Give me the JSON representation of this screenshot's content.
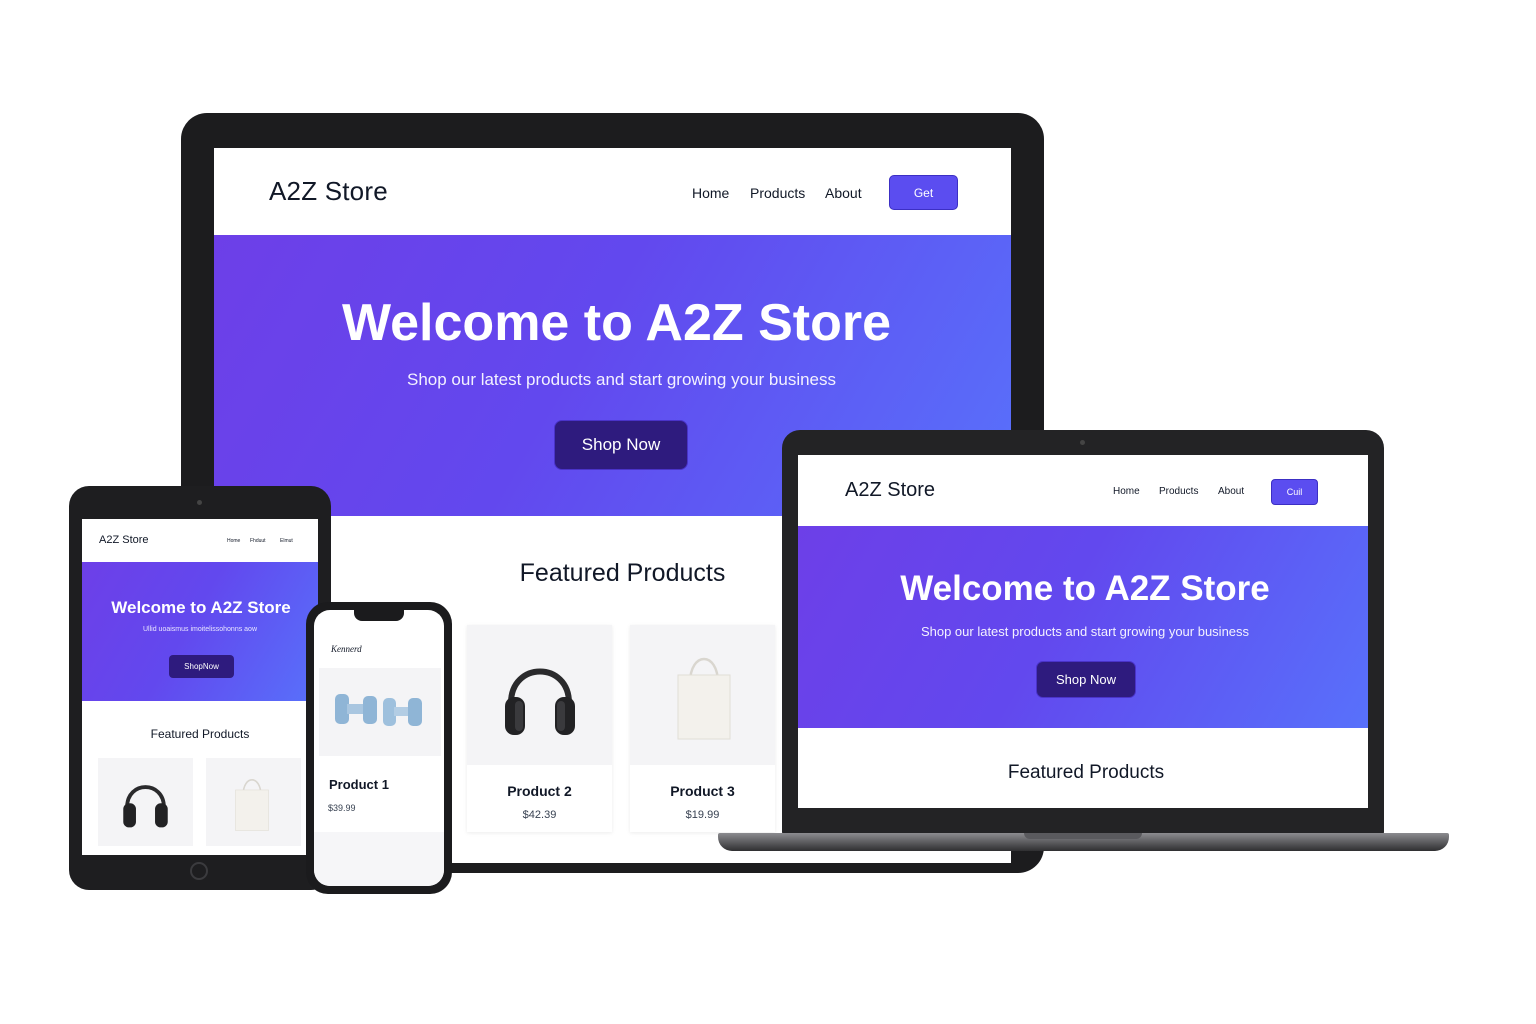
{
  "brand": {
    "name": "A2Z Store",
    "accent": "#5b4df0",
    "dark_button": "#2e1b7e"
  },
  "monitor": {
    "logo": "A2Z Store",
    "nav": [
      "Home",
      "Products",
      "About"
    ],
    "cta": "Get",
    "hero_title": "Welcome to A2Z Store",
    "hero_subtitle": "Shop our latest products and start growing your business",
    "hero_button": "Shop Now",
    "section_title": "Featured Products",
    "products": [
      {
        "name": "Product 2",
        "price": "$42.39",
        "image": "headphones-icon"
      },
      {
        "name": "Product 3",
        "price": "$19.99",
        "image": "tote-bag-icon"
      }
    ]
  },
  "laptop": {
    "logo": "A2Z Store",
    "nav": [
      "Home",
      "Products",
      "About"
    ],
    "cta": "Cuil",
    "hero_title": "Welcome to A2Z Store",
    "hero_subtitle": "Shop our latest products and start growing your business",
    "hero_button": "Shop Now",
    "section_title": "Featured Products"
  },
  "tablet": {
    "logo": "A2Z Store",
    "nav": [
      "Home",
      "Fhduut",
      "Elmut"
    ],
    "hero_title": "Welcome to A2Z Store",
    "hero_subtitle": "Ullid uoaismus imoitelissohonns aow",
    "hero_button": "ShopNow",
    "section_title": "Featured Products"
  },
  "phone": {
    "logo": "Kennerd",
    "product_name": "Product 1",
    "product_price": "$39.99",
    "image": "dumbbells-icon"
  }
}
